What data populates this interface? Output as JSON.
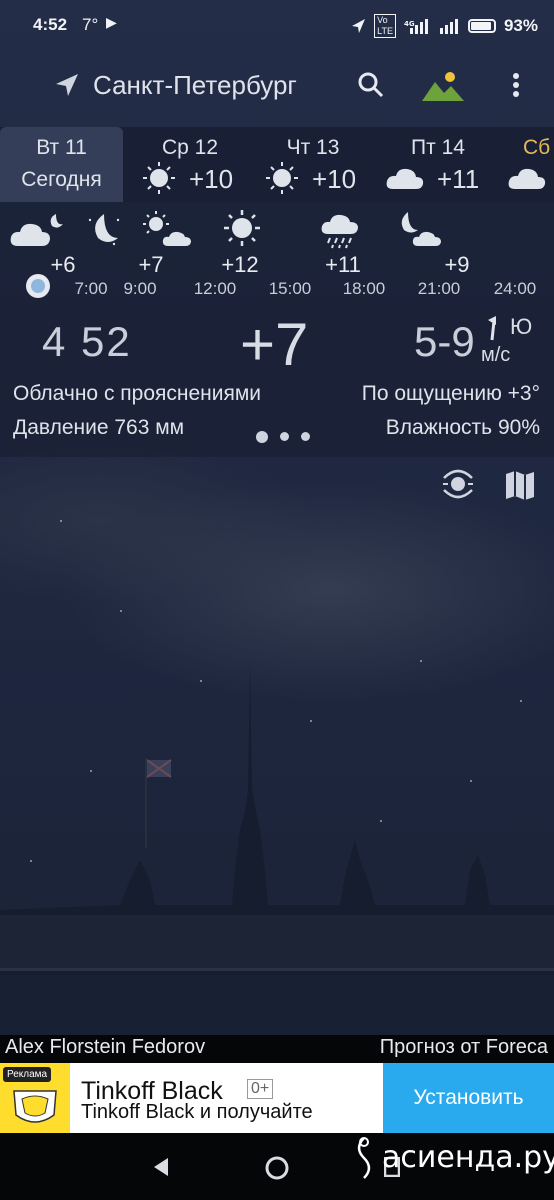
{
  "status_bar": {
    "time": "4:52",
    "temp": "7°",
    "battery": "93%",
    "icons": [
      "play-icon",
      "location-icon",
      "volte-icon",
      "4g-icon",
      "signal-icon",
      "signal-icon",
      "battery-icon"
    ]
  },
  "header": {
    "city": "Санкт-Петербург",
    "icons": [
      "navigation-arrow-icon",
      "search-icon",
      "landscape-icon",
      "more-vert-icon"
    ]
  },
  "days": [
    {
      "label": "Вт 11",
      "sub": "Сегодня",
      "active": true
    },
    {
      "label": "Ср 12",
      "temp": "+10",
      "icon": "sun-icon"
    },
    {
      "label": "Чт 13",
      "temp": "+10",
      "icon": "sun-icon"
    },
    {
      "label": "Пт 14",
      "temp": "+11",
      "icon": "cloud-icon"
    },
    {
      "label": "Сб",
      "icon": "cloud-icon"
    }
  ],
  "hourly": [
    {
      "time": "",
      "temp": "+6",
      "icon": "cloud-moon-icon"
    },
    {
      "time": "7:00",
      "temp": "",
      "icon": "moon-icon"
    },
    {
      "time": "9:00",
      "temp": "+7",
      "icon": "sun-cloud-icon"
    },
    {
      "time": "12:00",
      "temp": "+12",
      "icon": "sun-icon"
    },
    {
      "time": "15:00",
      "temp": "",
      "icon": ""
    },
    {
      "time": "18:00",
      "temp": "+11",
      "icon": "rain-cloud-icon"
    },
    {
      "time": "21:00",
      "temp": "+9",
      "icon": "moon-cloud-icon"
    },
    {
      "time": "24:00",
      "temp": "",
      "icon": ""
    }
  ],
  "current": {
    "time": "4 52",
    "temp": "+7",
    "wind_speed": "5-9",
    "wind_dir": "Ю",
    "wind_unit": "м/с",
    "description": "Облачно с прояснениями",
    "feels_like": "По ощущению +3°",
    "pressure": "Давление 763 мм",
    "humidity": "Влажность 90%"
  },
  "credits": {
    "photo": "Alex Florstein Fedorov",
    "forecast": "Прогноз от Foreca"
  },
  "ad": {
    "tag": "Реклама",
    "title": "Tinkoff Black",
    "age": "0+",
    "subtitle": "Tinkoff Black и получайте",
    "button": "Установить"
  },
  "watermark": "асиенда.ру",
  "colors": {
    "ad_button": "#29a9ee",
    "ad_logo": "#ffdd2d",
    "sky": "#1f2841"
  }
}
